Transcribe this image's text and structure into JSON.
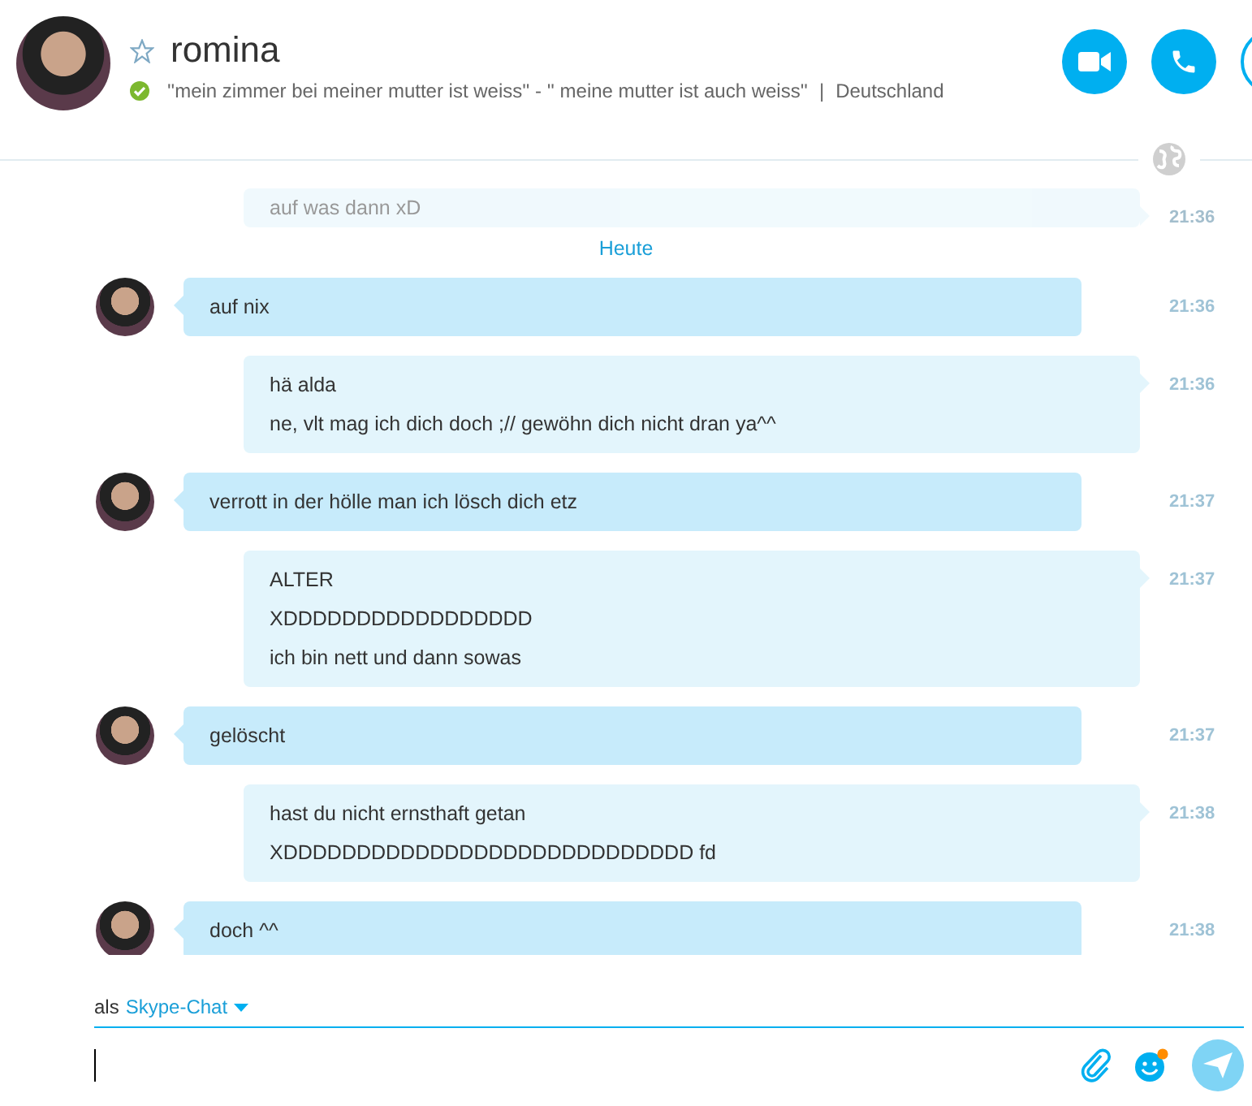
{
  "contact": {
    "name": "romina",
    "favorite": false,
    "online": true,
    "mood": "''mein zimmer bei meiner mutter ist weiss'' - '' meine mutter ist auch weiss''",
    "separator": "|",
    "location": "Deutschland"
  },
  "date_separator": "Heute",
  "messages": [
    {
      "kind": "outgoing",
      "faded": true,
      "lines": [
        "auf was dann xD"
      ],
      "time": "21:36"
    },
    {
      "kind": "incoming",
      "faded": false,
      "lines": [
        "auf nix"
      ],
      "time": "21:36"
    },
    {
      "kind": "outgoing",
      "faded": false,
      "lines": [
        "hä alda",
        "ne, vlt mag ich dich doch ;// gewöhn dich nicht dran ya^^"
      ],
      "time": "21:36"
    },
    {
      "kind": "incoming",
      "faded": false,
      "lines": [
        "verrott in der hölle man ich lösch dich etz"
      ],
      "time": "21:37"
    },
    {
      "kind": "outgoing",
      "faded": false,
      "lines": [
        "ALTER",
        "XDDDDDDDDDDDDDDDDD",
        "ich bin nett und dann sowas"
      ],
      "time": "21:37"
    },
    {
      "kind": "incoming",
      "faded": false,
      "lines": [
        "gelöscht"
      ],
      "time": "21:37"
    },
    {
      "kind": "outgoing",
      "faded": false,
      "lines": [
        "hast du nicht ernsthaft getan",
        "XDDDDDDDDDDDDDDDDDDDDDDDDDDDD fd"
      ],
      "time": "21:38"
    },
    {
      "kind": "incoming",
      "faded": false,
      "lines": [
        "doch ^^"
      ],
      "time": "21:38"
    }
  ],
  "composer": {
    "prefix": "als",
    "channel": "Skype-Chat",
    "emoticon_notification": true
  }
}
